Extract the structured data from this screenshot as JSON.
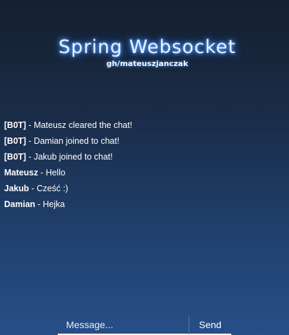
{
  "header": {
    "title": "Spring Websocket",
    "subtitle": "gh/mateuszjanczak"
  },
  "messages": [
    {
      "author": "[B0T]",
      "separator": " - ",
      "text": "Mateusz cleared the chat!"
    },
    {
      "author": "[B0T]",
      "separator": " - ",
      "text": "Damian joined to chat!"
    },
    {
      "author": "[B0T]",
      "separator": " - ",
      "text": "Jakub joined to chat!"
    },
    {
      "author": "Mateusz",
      "separator": " - ",
      "text": "Hello"
    },
    {
      "author": "Jakub",
      "separator": " - ",
      "text": "Cześć :)"
    },
    {
      "author": "Damian",
      "separator": " - ",
      "text": "Hejka"
    }
  ],
  "composer": {
    "placeholder": "Message...",
    "value": "",
    "send_label": "Send"
  }
}
